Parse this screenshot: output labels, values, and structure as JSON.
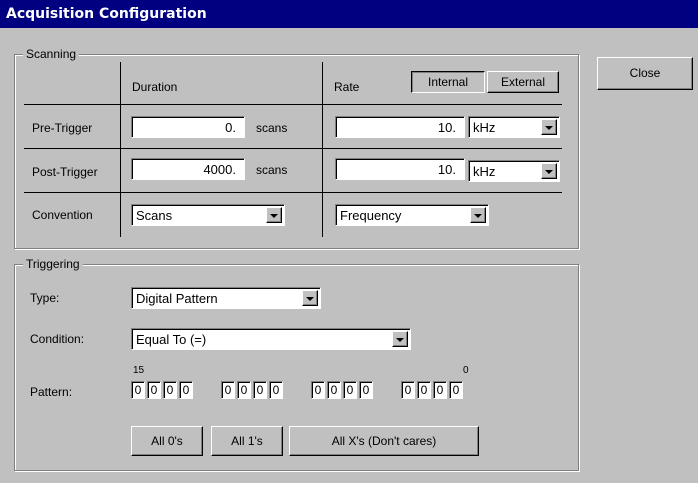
{
  "window": {
    "title": "Acquisition Configuration"
  },
  "buttons": {
    "close": "Close"
  },
  "scanning": {
    "legend": "Scanning",
    "col_duration": "Duration",
    "col_rate": "Rate",
    "clock_internal": "Internal",
    "clock_external": "External",
    "rows": {
      "pre_trigger": {
        "label": "Pre-Trigger",
        "duration": "0.",
        "duration_unit": "scans",
        "rate": "10.",
        "rate_unit": "kHz"
      },
      "post_trigger": {
        "label": "Post-Trigger",
        "duration": "4000.",
        "duration_unit": "scans",
        "rate": "10.",
        "rate_unit": "kHz"
      },
      "convention": {
        "label": "Convention",
        "duration_value": "Scans",
        "rate_value": "Frequency"
      }
    }
  },
  "triggering": {
    "legend": "Triggering",
    "type_label": "Type:",
    "type_value": "Digital Pattern",
    "condition_label": "Condition:",
    "condition_value": "Equal To (=)",
    "pattern_label": "Pattern:",
    "bit_high": "15",
    "bit_low": "0",
    "bits": [
      "0",
      "0",
      "0",
      "0",
      "0",
      "0",
      "0",
      "0",
      "0",
      "0",
      "0",
      "0",
      "0",
      "0",
      "0",
      "0"
    ],
    "all_zeros": "All 0's",
    "all_ones": "All 1's",
    "all_x": "All X's (Don't cares)"
  }
}
